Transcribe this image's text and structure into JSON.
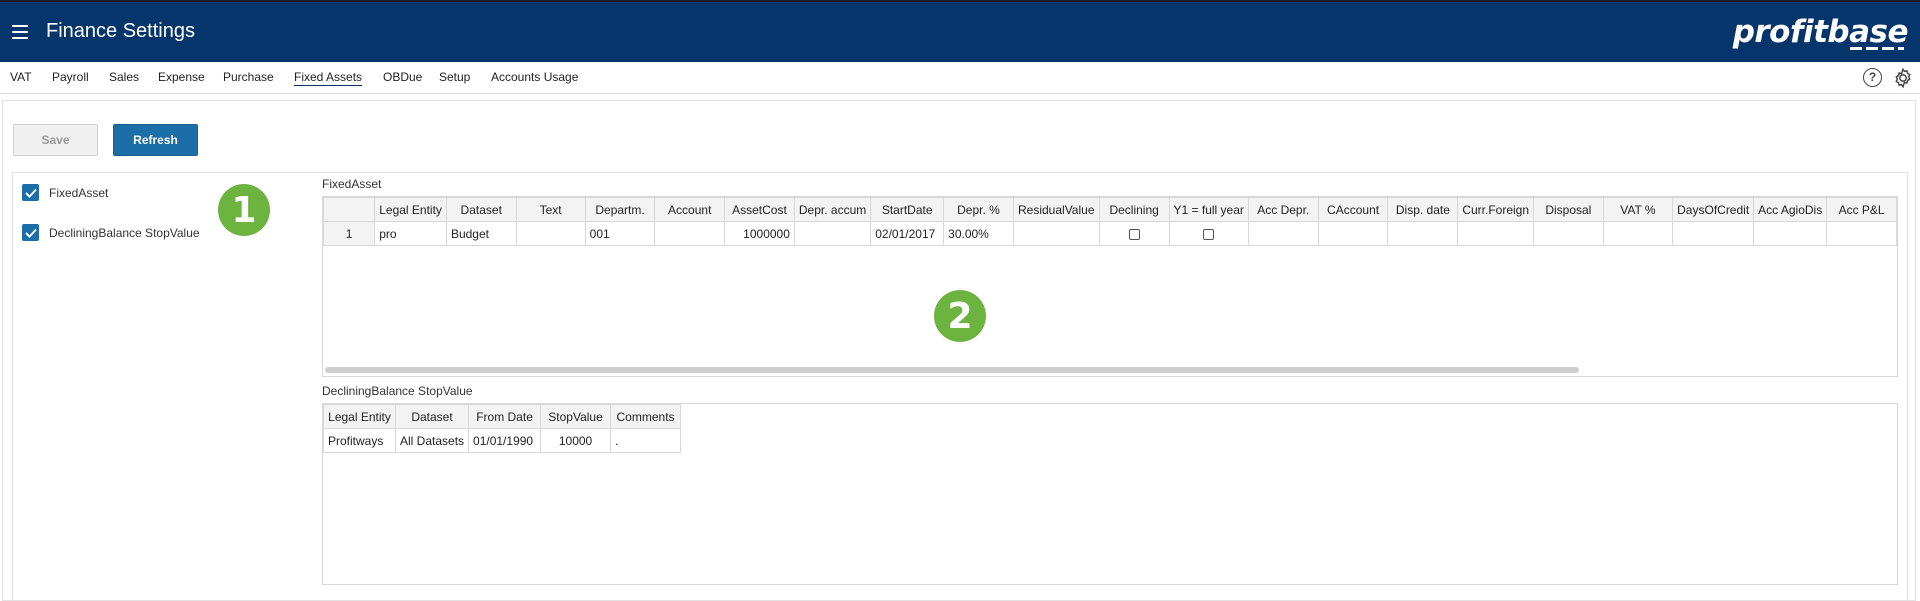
{
  "app": {
    "title": "Finance Settings",
    "logo": "profitbase"
  },
  "tabs": [
    {
      "label": "VAT"
    },
    {
      "label": "Payroll"
    },
    {
      "label": "Sales"
    },
    {
      "label": "Expense"
    },
    {
      "label": "Purchase"
    },
    {
      "label": "Fixed Assets"
    },
    {
      "label": "OBDue"
    },
    {
      "label": "Setup"
    },
    {
      "label": "Accounts Usage"
    }
  ],
  "active_tab": "Fixed Assets",
  "icons": {
    "help": "help-circle-icon",
    "settings": "gear-icon",
    "menu": "hamburger-icon"
  },
  "toolbar": {
    "save_label": "Save",
    "refresh_label": "Refresh"
  },
  "checkboxes": [
    {
      "label": "FixedAsset",
      "checked": true
    },
    {
      "label": "DecliningBalance StopValue",
      "checked": true
    }
  ],
  "badges": {
    "one": "1",
    "two": "2"
  },
  "fixed_asset": {
    "title": "FixedAsset",
    "columns": [
      "Legal Entity",
      "Dataset",
      "Text",
      "Departm.",
      "Account",
      "AssetCost",
      "Depr. accum",
      "StartDate",
      "Depr. %",
      "ResidualValue",
      "Declining",
      "Y1 = full year",
      "Acc Depr.",
      "CAccount",
      "Disp. date",
      "Curr.Foreign",
      "Disposal",
      "VAT %",
      "DaysOfCredit",
      "Acc AgioDis",
      "Acc P&L"
    ],
    "rows": [
      {
        "num": "1",
        "legal_entity": "pro",
        "dataset": "Budget",
        "text": "",
        "departm": "001",
        "account": "",
        "asset_cost": "1000000",
        "depr_accum": "",
        "start_date": "02/01/2017",
        "depr_pct": "30.00%",
        "residual": "",
        "declining": false,
        "y1_full_year": false
      }
    ]
  },
  "declining_balance": {
    "title": "DecliningBalance StopValue",
    "columns": [
      "Legal Entity",
      "Dataset",
      "From Date",
      "StopValue",
      "Comments"
    ],
    "rows": [
      {
        "legal_entity": "Profitways",
        "dataset": "All Datasets",
        "from_date": "01/01/1990",
        "stop_value": "10000",
        "comments": "."
      }
    ]
  },
  "colors": {
    "header_bg": "#06356b",
    "accent": "#1b6ea8",
    "badge": "#6db33f"
  }
}
